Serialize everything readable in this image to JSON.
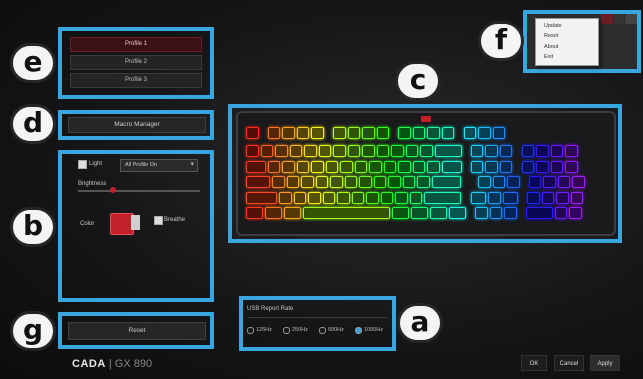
{
  "profiles": [
    "Profile 1",
    "Profile 2",
    "Profile 3"
  ],
  "macro_button": "Macro Manager",
  "lighting": {
    "light_label": "Light",
    "effect_value": "All Profile On",
    "brightness_label": "Brightness",
    "color_label": "Color",
    "breathe_label": "Breathe"
  },
  "reset_label": "Reset",
  "polling": {
    "title": "USB Report Rate",
    "options": [
      "125Hz",
      "250Hz",
      "500Hz",
      "1000Hz"
    ]
  },
  "menu": [
    "Update",
    "Reset",
    "About",
    "Exit"
  ],
  "brand": {
    "name": "CADA",
    "separator": "|",
    "model": "GX 890"
  },
  "bottom_buttons": [
    "OK",
    "Cancel",
    "Apply"
  ],
  "callouts": [
    "a",
    "b",
    "c",
    "d",
    "e",
    "f",
    "g"
  ],
  "colors": {
    "accent_blue": "#39a6df",
    "active_red": "#c4202a"
  }
}
